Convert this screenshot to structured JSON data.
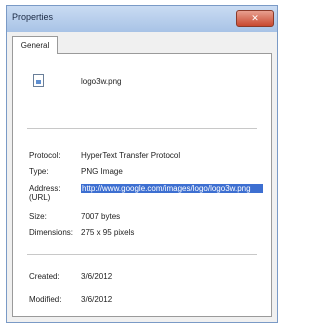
{
  "window": {
    "title": "Properties",
    "close_icon": "close-icon"
  },
  "tabs": [
    {
      "label": "General"
    }
  ],
  "file": {
    "icon": "image-file-icon",
    "name": "logo3w.png"
  },
  "details": {
    "protocol": {
      "label": "Protocol:",
      "value": "HyperText Transfer Protocol"
    },
    "type": {
      "label": "Type:",
      "value": "PNG Image"
    },
    "address": {
      "label_line1": "Address:",
      "label_line2": "(URL)",
      "value": "http://www.google.com/images/logo/logo3w.png"
    },
    "size": {
      "label": "Size:",
      "value": "7007 bytes"
    },
    "dimensions": {
      "label": "Dimensions:",
      "value": "275 x 95 pixels"
    },
    "created": {
      "label": "Created:",
      "value": "3/6/2012"
    },
    "modified": {
      "label": "Modified:",
      "value": "3/6/2012"
    }
  }
}
